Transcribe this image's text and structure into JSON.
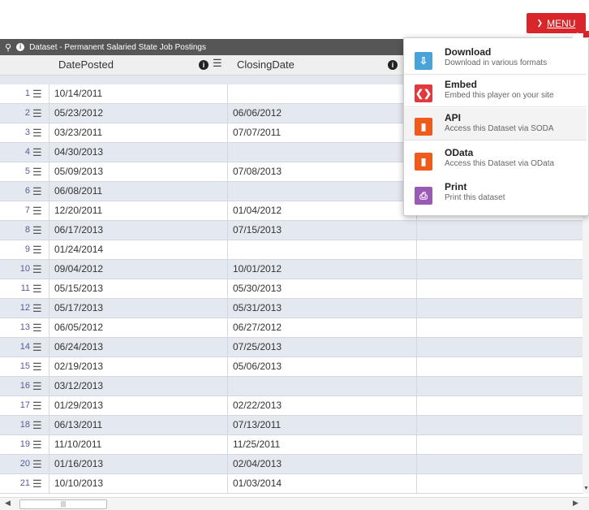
{
  "menu_button": {
    "label": "MENU",
    "icon": "chevron-down-icon",
    "color": "#d9262b"
  },
  "titlebar": {
    "title": "Dataset - Permanent Salaried State Job Postings",
    "icons": [
      "search-icon",
      "info-icon"
    ]
  },
  "columns": [
    {
      "label": "DatePosted"
    },
    {
      "label": "ClosingDate"
    }
  ],
  "rows": [
    {
      "num": "1",
      "posted": "10/14/2011",
      "closing": ""
    },
    {
      "num": "2",
      "posted": "05/23/2012",
      "closing": "06/06/2012"
    },
    {
      "num": "3",
      "posted": "03/23/2011",
      "closing": "07/07/2011"
    },
    {
      "num": "4",
      "posted": "04/30/2013",
      "closing": ""
    },
    {
      "num": "5",
      "posted": "05/09/2013",
      "closing": "07/08/2013"
    },
    {
      "num": "6",
      "posted": "06/08/2011",
      "closing": ""
    },
    {
      "num": "7",
      "posted": "12/20/2011",
      "closing": "01/04/2012"
    },
    {
      "num": "8",
      "posted": "06/17/2013",
      "closing": "07/15/2013"
    },
    {
      "num": "9",
      "posted": "01/24/2014",
      "closing": ""
    },
    {
      "num": "10",
      "posted": "09/04/2012",
      "closing": "10/01/2012"
    },
    {
      "num": "11",
      "posted": "05/15/2013",
      "closing": "05/30/2013"
    },
    {
      "num": "12",
      "posted": "05/17/2013",
      "closing": "05/31/2013"
    },
    {
      "num": "13",
      "posted": "06/05/2012",
      "closing": "06/27/2012"
    },
    {
      "num": "14",
      "posted": "06/24/2013",
      "closing": "07/25/2013"
    },
    {
      "num": "15",
      "posted": "02/19/2013",
      "closing": "05/06/2013"
    },
    {
      "num": "16",
      "posted": "03/12/2013",
      "closing": ""
    },
    {
      "num": "17",
      "posted": "01/29/2013",
      "closing": "02/22/2013"
    },
    {
      "num": "18",
      "posted": "06/13/2011",
      "closing": "07/13/2011"
    },
    {
      "num": "19",
      "posted": "11/10/2011",
      "closing": "11/25/2011"
    },
    {
      "num": "20",
      "posted": "01/16/2013",
      "closing": "02/04/2013"
    },
    {
      "num": "21",
      "posted": "10/10/2013",
      "closing": "01/03/2014"
    }
  ],
  "dropdown": {
    "items": [
      {
        "title": "Download",
        "desc": "Download in various formats",
        "icon": "download-icon",
        "color": "#4aa3d8"
      },
      {
        "title": "Embed",
        "desc": "Embed this player on your site",
        "icon": "embed-icon",
        "color": "#e0393e"
      },
      {
        "title": "API",
        "desc": "Access this Dataset via SODA",
        "icon": "api-icon",
        "color": "#f05a1a"
      },
      {
        "title": "OData",
        "desc": "Access this Dataset via OData",
        "icon": "odata-icon",
        "color": "#f05a1a"
      },
      {
        "title": "Print",
        "desc": "Print this dataset",
        "icon": "print-icon",
        "color": "#9b59b6"
      }
    ]
  }
}
